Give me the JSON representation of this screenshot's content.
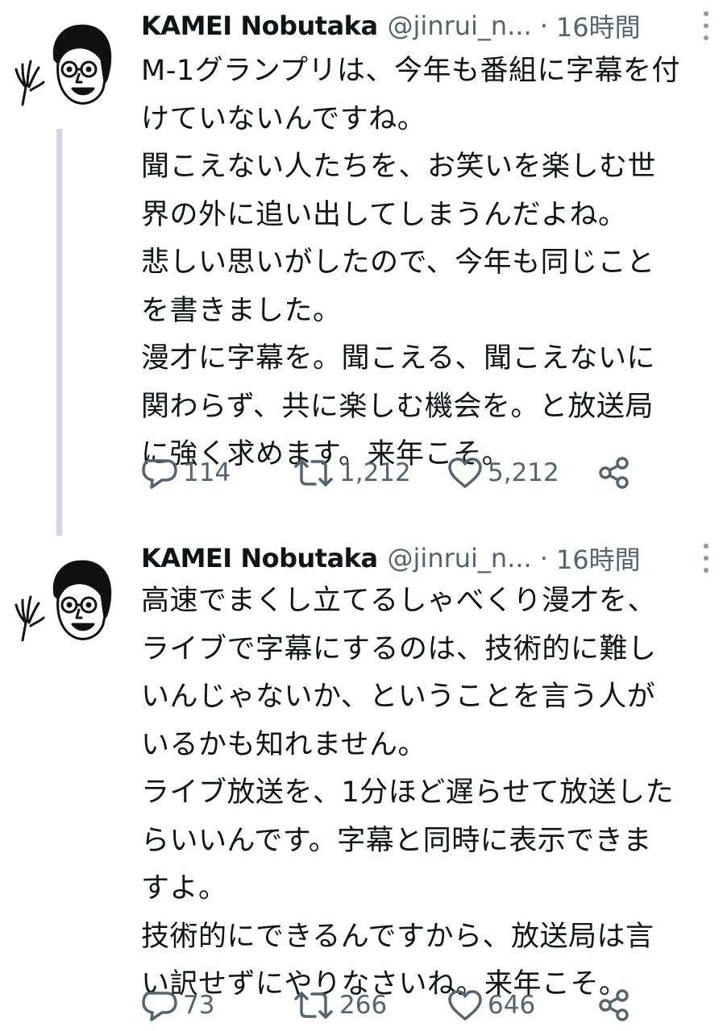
{
  "tweets": [
    {
      "author_name": "KAMEI Nobutaka",
      "handle": "@jinrui_n...",
      "separator": "·",
      "time": "16時間",
      "text": "M-1グランプリは、今年も番組に字幕を付\nけていないんですね。\n聞こえない人たちを、お笑いを楽しむ世\n界の外に追い出してしまうんだよね。\n悲しい思いがしたので、今年も同じこと\nを書きました。\n漫才に字幕を。聞こえる、聞こえないに\n関わらず、共に楽しむ機会を。と放送局\nに強く求めます。来年こそ。",
      "replies": "114",
      "retweets": "1,212",
      "likes": "5,212"
    },
    {
      "author_name": "KAMEI Nobutaka",
      "handle": "@jinrui_n...",
      "separator": "·",
      "time": "16時間",
      "text": "高速でまくし立てるしゃべくり漫才を、\nライブで字幕にするのは、技術的に難し\nいんじゃないか、ということを言う人が\nいるかも知れません。\nライブ放送を、1分ほど遅らせて放送した\nらいいんです。字幕と同時に表示できま\nすよ。\n技術的にできるんですから、放送局は言\nい訳せずにやりなさいね。来年こそ。",
      "replies": "73",
      "retweets": "266",
      "likes": "646"
    }
  ],
  "icons": {
    "avatar": "waving-cartoon-avatar",
    "reply": "reply-icon",
    "retweet": "retweet-icon",
    "like": "heart-icon",
    "share": "share-icon",
    "more": "more-options-icon"
  },
  "colors": {
    "text": "#0f1419",
    "muted": "#536471",
    "thread_line": "#cfd9de"
  }
}
